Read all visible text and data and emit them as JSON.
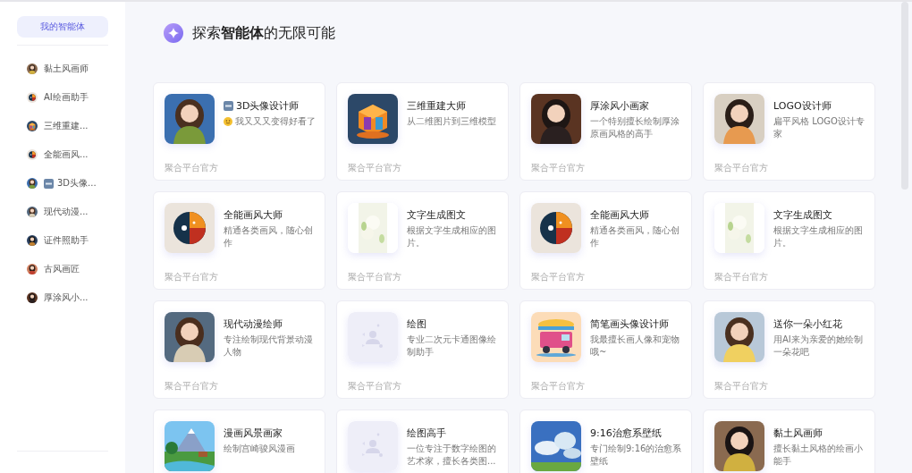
{
  "sidebar": {
    "tab": {
      "label": "我的智能体",
      "selected": true
    },
    "items": [
      {
        "label": "黏土风画师",
        "new_badge": false,
        "selected": false
      },
      {
        "label": "AI绘画助手",
        "new_badge": false,
        "selected": false
      },
      {
        "label": "三维重建...",
        "new_badge": false,
        "selected": false
      },
      {
        "label": "全能画风...",
        "new_badge": false,
        "selected": false
      },
      {
        "label": "3D头像...",
        "new_badge": true,
        "selected": false
      },
      {
        "label": "现代动漫...",
        "new_badge": false,
        "selected": false
      },
      {
        "label": "证件照助手",
        "new_badge": false,
        "selected": false
      },
      {
        "label": "古风画匠",
        "new_badge": false,
        "selected": false
      },
      {
        "label": "厚涂风小...",
        "new_badge": false,
        "selected": false
      }
    ]
  },
  "header": {
    "title": "探索**智能体**的无限可能"
  },
  "cards": [
    {
      "kind": "picture",
      "title": "3D头像设计师",
      "title_badge": true,
      "description": "我又又又变得好看了",
      "smiley_icon": true,
      "publisher": "聚合平台官方"
    },
    {
      "kind": "picture",
      "title": "三维重建大师",
      "title_badge": false,
      "description": "从二维图片到三维模型",
      "smiley_icon": false,
      "publisher": "聚合平台官方"
    },
    {
      "kind": "picture",
      "title": "厚涂风小画家",
      "title_badge": false,
      "description": "一个特别擅长绘制厚涂原画风格的高手",
      "smiley_icon": false,
      "publisher": "聚合平台官方"
    },
    {
      "kind": "picture",
      "title": "LOGO设计师",
      "title_badge": false,
      "description": "扁平风格 LOGO设计专家",
      "smiley_icon": false,
      "publisher": "聚合平台官方"
    },
    {
      "kind": "picture",
      "title": "全能画风大师",
      "title_badge": false,
      "description": "精通各类画风，随心创作",
      "smiley_icon": false,
      "publisher": "聚合平台官方"
    },
    {
      "kind": "picture",
      "title": "文字生成图文",
      "title_badge": false,
      "description": "根据文字生成相应的图片。",
      "smiley_icon": false,
      "publisher": "聚合平台官方"
    },
    {
      "kind": "picture",
      "title": "全能画风大师",
      "title_badge": false,
      "description": "精通各类画风，随心创作",
      "smiley_icon": false,
      "publisher": "聚合平台官方"
    },
    {
      "kind": "picture",
      "title": "文字生成图文",
      "title_badge": false,
      "description": "根据文字生成相应的图片。",
      "smiley_icon": false,
      "publisher": "聚合平台官方"
    },
    {
      "kind": "picture",
      "title": "现代动漫绘师",
      "title_badge": false,
      "description": "专注绘制现代背景动漫人物",
      "smiley_icon": false,
      "publisher": "聚合平台官方"
    },
    {
      "kind": "placeholder",
      "title": "绘图",
      "title_badge": false,
      "description": "专业二次元卡通图像绘制助手",
      "smiley_icon": false,
      "publisher": "聚合平台官方"
    },
    {
      "kind": "picture",
      "title": "简笔画头像设计师",
      "title_badge": false,
      "description": "我最擅长画人像和宠物哦~",
      "smiley_icon": false,
      "publisher": "聚合平台官方"
    },
    {
      "kind": "picture",
      "title": "送你一朵小红花",
      "title_badge": false,
      "description": "用AI来为亲爱的她绘制一朵花吧",
      "smiley_icon": false,
      "publisher": "聚合平台官方"
    },
    {
      "kind": "picture",
      "title": "漫画风景画家",
      "title_badge": false,
      "description": "绘制宫崎骏风漫画",
      "smiley_icon": false
    },
    {
      "kind": "placeholder",
      "title": "绘图高手",
      "title_badge": false,
      "description": "一位专注于数字绘图的艺术家，擅长各类图...",
      "smiley_icon": false
    },
    {
      "kind": "picture",
      "title": "9:16治愈系壁纸",
      "title_badge": false,
      "description": "专门绘制9:16的治愈系壁纸",
      "smiley_icon": false
    },
    {
      "kind": "picture",
      "title": "黏土风画师",
      "title_badge": false,
      "description": "擅长黏土风格的绘画小能手",
      "smiley_icon": false
    }
  ]
}
